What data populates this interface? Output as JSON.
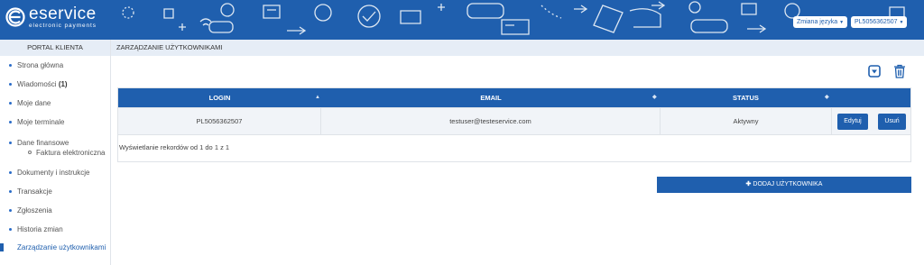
{
  "header": {
    "brand": "eservice",
    "brand_sub": "electronic payments",
    "language_button": "Zmiana języka",
    "user_button": "PL5056362507"
  },
  "sidebar": {
    "title": "PORTAL KLIENTA",
    "items": [
      {
        "label": "Strona główna"
      },
      {
        "label": "Wiadomości",
        "count": "(1)"
      },
      {
        "label": "Moje dane"
      },
      {
        "label": "Moje terminale"
      },
      {
        "label": "Dane finansowe",
        "sub": "Faktura elektroniczna"
      },
      {
        "label": "Dokumenty i instrukcje"
      },
      {
        "label": "Transakcje"
      },
      {
        "label": "Zgłoszenia"
      },
      {
        "label": "Historia zmian"
      },
      {
        "label": "Zarządzanie użytkownikami",
        "active": true
      }
    ]
  },
  "main": {
    "title": "ZARZĄDZANIE UŻYTKOWNIKAMI",
    "table": {
      "columns": [
        "LOGIN",
        "EMAIL",
        "STATUS"
      ],
      "rows": [
        {
          "login": "PL5056362507",
          "email": "testuser@testeservice.com",
          "status": "Aktywny",
          "edit": "Edytuj",
          "delete": "Usuń"
        }
      ],
      "footer": "Wyświetlanie rekordów od 1 do 1 z 1"
    },
    "add_button": "DODAJ UŻYTKOWNIKA"
  },
  "colors": {
    "brand_blue": "#1f5fae",
    "panel_bg": "#e6edf6",
    "row_bg": "#f1f4f8"
  },
  "icons": [
    "export-dropdown-icon",
    "trash-icon",
    "plus-icon",
    "sort-icon"
  ]
}
